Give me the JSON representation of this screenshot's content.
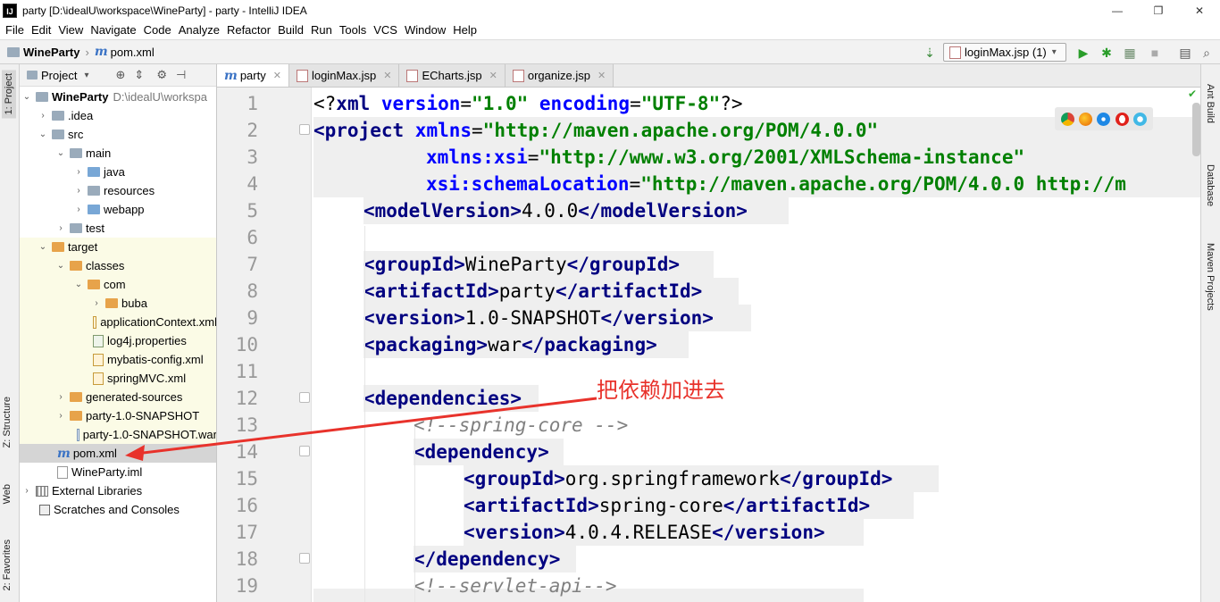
{
  "window": {
    "title": "party [D:\\idealU\\workspace\\WineParty] - party - IntelliJ IDEA",
    "app_icon": "IJ",
    "controls": [
      "—",
      "❐",
      "✕"
    ]
  },
  "menu": [
    "File",
    "Edit",
    "View",
    "Navigate",
    "Code",
    "Analyze",
    "Refactor",
    "Build",
    "Run",
    "Tools",
    "VCS",
    "Window",
    "Help"
  ],
  "breadcrumb": {
    "project": "WineParty",
    "file": "pom.xml"
  },
  "run_config": "loginMax.jsp (1)",
  "left_tools": [
    "1: Project",
    "Z: Structure",
    "Web",
    "2: Favorites"
  ],
  "right_tools": [
    "Ant Build",
    "Database",
    "Maven Projects"
  ],
  "project_panel": {
    "title": "Project",
    "nodes": [
      {
        "label": "WineParty",
        "extra": "D:\\idealU\\workspa",
        "arrow": "⌄"
      },
      {
        "label": ".idea",
        "arrow": "›"
      },
      {
        "label": "src",
        "arrow": "⌄"
      },
      {
        "label": "main",
        "arrow": "⌄"
      },
      {
        "label": "java",
        "arrow": "›"
      },
      {
        "label": "resources",
        "arrow": "›"
      },
      {
        "label": "webapp",
        "arrow": "›"
      },
      {
        "label": "test",
        "arrow": "›"
      },
      {
        "label": "target",
        "arrow": "⌄"
      },
      {
        "label": "classes",
        "arrow": "⌄"
      },
      {
        "label": "com",
        "arrow": "⌄"
      },
      {
        "label": "buba",
        "arrow": "›"
      },
      {
        "label": "applicationContext.xml",
        "arrow": ""
      },
      {
        "label": "log4j.properties",
        "arrow": ""
      },
      {
        "label": "mybatis-config.xml",
        "arrow": ""
      },
      {
        "label": "springMVC.xml",
        "arrow": ""
      },
      {
        "label": "generated-sources",
        "arrow": "›"
      },
      {
        "label": "party-1.0-SNAPSHOT",
        "arrow": "›"
      },
      {
        "label": "party-1.0-SNAPSHOT.war",
        "arrow": ""
      },
      {
        "label": "pom.xml",
        "arrow": ""
      },
      {
        "label": "WineParty.iml",
        "arrow": ""
      },
      {
        "label": "External Libraries",
        "arrow": "›"
      },
      {
        "label": "Scratches and Consoles",
        "arrow": ""
      }
    ]
  },
  "tabs": [
    {
      "label": "party",
      "active": true
    },
    {
      "label": "loginMax.jsp",
      "active": false
    },
    {
      "label": "ECharts.jsp",
      "active": false
    },
    {
      "label": "organize.jsp",
      "active": false
    }
  ],
  "editor": {
    "line_numbers": [
      "1",
      "2",
      "3",
      "4",
      "5",
      "6",
      "7",
      "8",
      "9",
      "10",
      "11",
      "12",
      "13",
      "14",
      "15",
      "16",
      "17",
      "18",
      "19"
    ],
    "code": {
      "l1a": "<?",
      "l1b": "xml ",
      "l1c": "version",
      "l1d": "=",
      "l1e": "\"1.0\"",
      "l1f": " encoding",
      "l1g": "=",
      "l1h": "\"UTF-8\"",
      "l1i": "?>",
      "l2a": "<project ",
      "l2b": "xmlns",
      "l2c": "=",
      "l2d": "\"http://maven.apache.org/POM/4.0.0\"",
      "l3a": "xmlns:xsi",
      "l3b": "=",
      "l3c": "\"http://www.w3.org/2001/XMLSchema-instance\"",
      "l4a": "xsi:schemaLocation",
      "l4b": "=",
      "l4c": "\"http://maven.apache.org/POM/4.0.0 http://m",
      "l5a": "<modelVersion>",
      "l5b": "4.0.0",
      "l5c": "</modelVersion>",
      "l7a": "<groupId>",
      "l7b": "WineParty",
      "l7c": "</groupId>",
      "l8a": "<artifactId>",
      "l8b": "party",
      "l8c": "</artifactId>",
      "l9a": "<version>",
      "l9b": "1.0-SNAPSHOT",
      "l9c": "</version>",
      "l10a": "<packaging>",
      "l10b": "war",
      "l10c": "</packaging>",
      "l12a": "<dependencies>",
      "l13a": "<!--spring-core -->",
      "l14a": "<dependency>",
      "l15a": "<groupId>",
      "l15b": "org.springframework",
      "l15c": "</groupId>",
      "l16a": "<artifactId>",
      "l16b": "spring-core",
      "l16c": "</artifactId>",
      "l17a": "<version>",
      "l17b": "4.0.4.RELEASE",
      "l17c": "</version>",
      "l18a": "</dependency>",
      "l19a": "<!--servlet-api-->"
    }
  },
  "annotation": "把依赖加进去",
  "colors": {
    "tag": "#000080",
    "attr": "#0000ff",
    "value": "#008000",
    "comment": "#808080",
    "annotation": "#e8322b"
  }
}
